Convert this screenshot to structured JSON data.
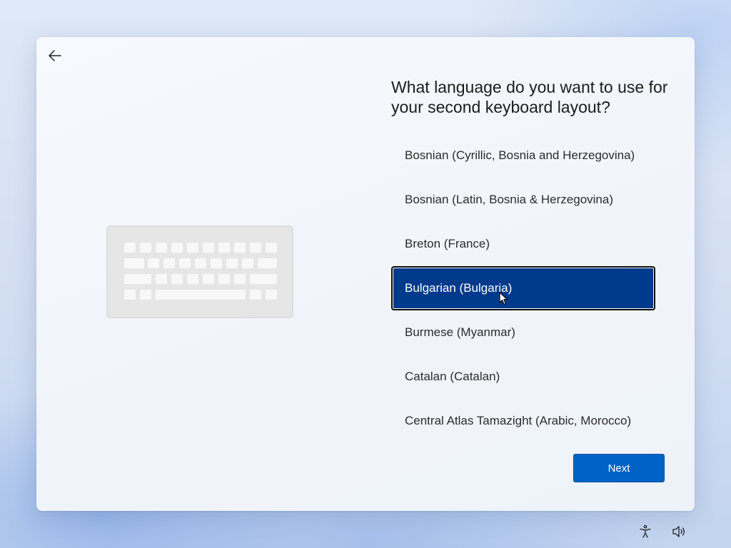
{
  "page": {
    "title": "What language do you want to use for your second keyboard layout?",
    "accent_color": "#0062c4",
    "selected_color": "#003a8c"
  },
  "icons": {
    "back": "back-arrow-icon",
    "keyboard": "keyboard-illustration",
    "accessibility": "accessibility-icon",
    "volume": "volume-icon",
    "cursor": "mouse-pointer-icon"
  },
  "languages": [
    {
      "label": "Bosnian (Cyrillic, Bosnia and Herzegovina)",
      "selected": false
    },
    {
      "label": "Bosnian (Latin, Bosnia & Herzegovina)",
      "selected": false
    },
    {
      "label": "Breton (France)",
      "selected": false
    },
    {
      "label": "Bulgarian (Bulgaria)",
      "selected": true
    },
    {
      "label": "Burmese (Myanmar)",
      "selected": false
    },
    {
      "label": "Catalan (Catalan)",
      "selected": false
    },
    {
      "label": "Central Atlas Tamazight (Arabic, Morocco)",
      "selected": false
    }
  ],
  "buttons": {
    "next_label": "Next"
  }
}
